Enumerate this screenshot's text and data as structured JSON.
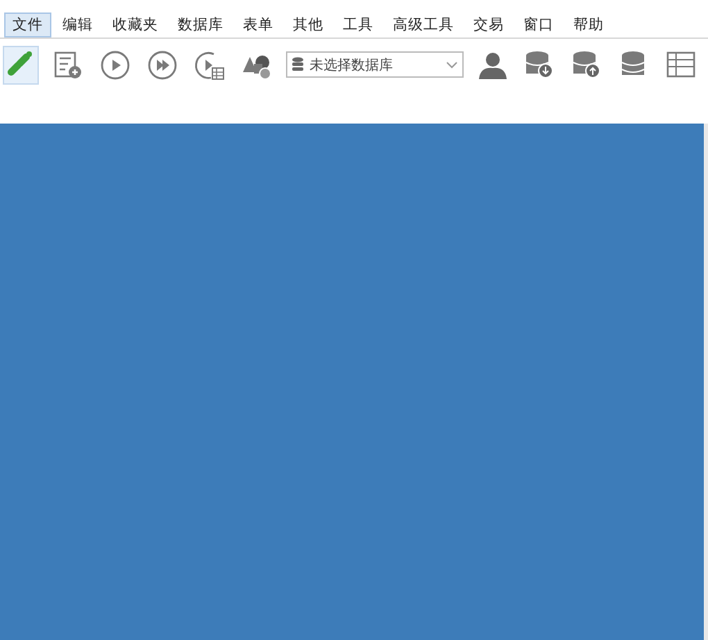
{
  "menu": [
    {
      "label": "文件",
      "selected": true
    },
    {
      "label": "编辑",
      "selected": false
    },
    {
      "label": "收藏夹",
      "selected": false
    },
    {
      "label": "数据库",
      "selected": false
    },
    {
      "label": "表单",
      "selected": false
    },
    {
      "label": "其他",
      "selected": false
    },
    {
      "label": "工具",
      "selected": false
    },
    {
      "label": "高级工具",
      "selected": false
    },
    {
      "label": "交易",
      "selected": false
    },
    {
      "label": "窗口",
      "selected": false
    },
    {
      "label": "帮助",
      "selected": false
    }
  ],
  "toolbar": [
    {
      "kind": "connect",
      "selected": true
    },
    {
      "kind": "query",
      "selected": false
    },
    {
      "kind": "play",
      "selected": false
    },
    {
      "kind": "playall",
      "selected": false
    },
    {
      "kind": "playgrid",
      "selected": false
    },
    {
      "kind": "shapes",
      "selected": false
    },
    {
      "kind": "dropdown",
      "placeholder": "未选择数据库"
    },
    {
      "kind": "user",
      "selected": false
    },
    {
      "kind": "dbdown",
      "selected": false
    },
    {
      "kind": "dbup",
      "selected": false
    },
    {
      "kind": "dbsync",
      "selected": false
    },
    {
      "kind": "table",
      "selected": false
    }
  ]
}
